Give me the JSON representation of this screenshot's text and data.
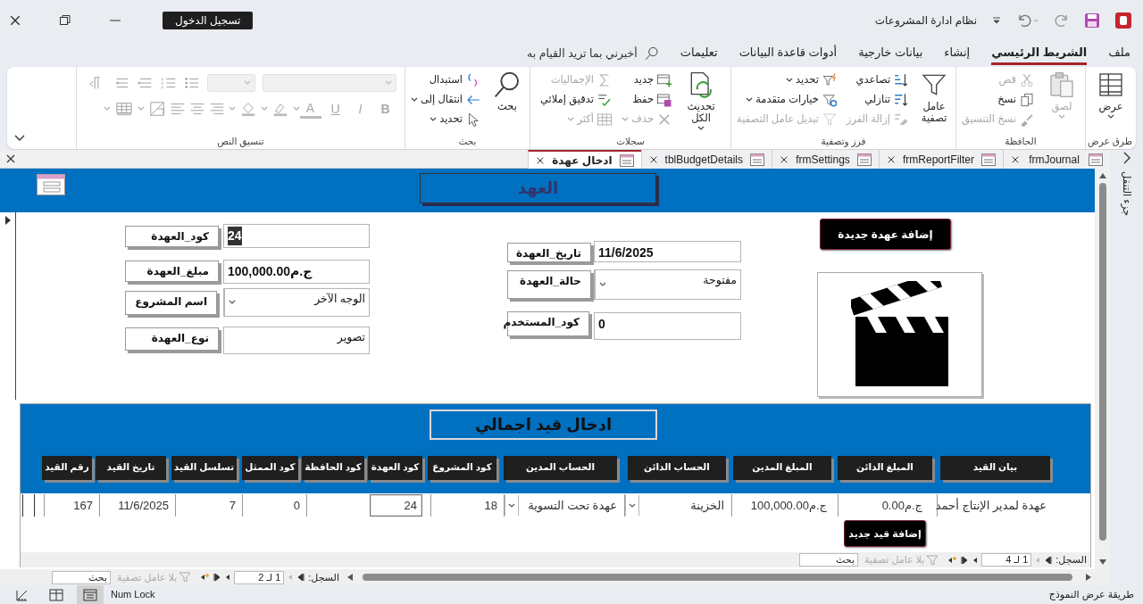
{
  "title_bar": {
    "title": "نظام ادارة المشروعات",
    "sign_in": "تسجيل الدخول"
  },
  "ribbon_tabs": [
    {
      "label": "ملف",
      "selected": false
    },
    {
      "label": "الشريط الرئيسي",
      "selected": true
    },
    {
      "label": "إنشاء",
      "selected": false
    },
    {
      "label": "بيانات خارجية",
      "selected": false
    },
    {
      "label": "أدوات قاعدة البيانات",
      "selected": false
    },
    {
      "label": "تعليمات",
      "selected": false
    }
  ],
  "tell_me": {
    "placeholder": "أخبرني بما تريد القيام به"
  },
  "ribbon_groups": [
    {
      "label": "طرق عرض",
      "commands": [
        {
          "label": "عرض",
          "kind": "large",
          "disabled": false,
          "dropdown": true
        }
      ]
    },
    {
      "label": "الحافظة",
      "commands": [
        {
          "label": "لصق",
          "kind": "large",
          "disabled": true,
          "dropdown": true
        },
        {
          "label": "قص",
          "kind": "small",
          "disabled": true,
          "dropdown": false
        },
        {
          "label": "نسخ",
          "kind": "small",
          "disabled": false,
          "dropdown": false
        },
        {
          "label": "نسخ التنسيق",
          "kind": "small",
          "disabled": true,
          "dropdown": false
        }
      ]
    },
    {
      "label": "فرز وتصفية",
      "commands": [
        {
          "label": "عامل تصفية",
          "kind": "large",
          "disabled": false,
          "dropdown": false
        },
        {
          "label": "تصاعدي",
          "kind": "small",
          "disabled": false,
          "dropdown": false
        },
        {
          "label": "تنازلي",
          "kind": "small",
          "disabled": false,
          "dropdown": false
        },
        {
          "label": "إزالة الفرز",
          "kind": "small",
          "disabled": true,
          "dropdown": false
        },
        {
          "label": "تحديد",
          "kind": "small",
          "disabled": false,
          "dropdown": true
        },
        {
          "label": "خيارات متقدمة",
          "kind": "small",
          "disabled": false,
          "dropdown": true
        },
        {
          "label": "تبديل عامل التصفية",
          "kind": "small",
          "disabled": true,
          "dropdown": false
        }
      ]
    },
    {
      "label": "سجلات",
      "commands": [
        {
          "label": "تحديث الكل",
          "kind": "large",
          "disabled": false,
          "dropdown": true
        },
        {
          "label": "جديد",
          "kind": "small",
          "disabled": false,
          "dropdown": false
        },
        {
          "label": "حفظ",
          "kind": "small",
          "disabled": false,
          "dropdown": false
        },
        {
          "label": "حذف",
          "kind": "small",
          "disabled": true,
          "dropdown": true
        },
        {
          "label": "الإجماليات",
          "kind": "small",
          "disabled": true,
          "dropdown": false
        },
        {
          "label": "تدقيق إملائي",
          "kind": "small",
          "disabled": false,
          "dropdown": false
        },
        {
          "label": "أكثر",
          "kind": "small",
          "disabled": true,
          "dropdown": true
        }
      ]
    },
    {
      "label": "بحث",
      "commands": [
        {
          "label": "بحث",
          "kind": "large",
          "disabled": false,
          "dropdown": false
        },
        {
          "label": "استبدال",
          "kind": "small",
          "disabled": false,
          "dropdown": false
        },
        {
          "label": "انتقال إلى",
          "kind": "small",
          "disabled": false,
          "dropdown": true
        },
        {
          "label": "تحديد",
          "kind": "small",
          "disabled": false,
          "dropdown": true
        }
      ]
    },
    {
      "label": "تنسيق النص",
      "commands": [
        {
          "label": "B",
          "kind": "glyph",
          "disabled": true,
          "dropdown": false
        },
        {
          "label": "I",
          "kind": "glyph",
          "disabled": true,
          "dropdown": false
        },
        {
          "label": "U",
          "kind": "glyph",
          "disabled": true,
          "dropdown": false
        },
        {
          "label": "A",
          "kind": "glyph",
          "disabled": true,
          "dropdown": true
        }
      ]
    }
  ],
  "doc_tabs": [
    {
      "label": "frmJournal",
      "selected": false
    },
    {
      "label": "frmReportFilter",
      "selected": false
    },
    {
      "label": "frmSettings",
      "selected": false
    },
    {
      "label": "tblBudgetDetails",
      "selected": false
    },
    {
      "label": "ادخال عهدة",
      "selected": true
    }
  ],
  "nav_pane": {
    "label": "جزء التنقل"
  },
  "form": {
    "title": "العهد",
    "new_button": "إضافة عهدة جديدة",
    "fields": [
      {
        "label": "تاريخ_العهدة",
        "value": "11/6/2025",
        "kind": "number",
        "text_selected": false
      },
      {
        "label": "حالة_العهدة",
        "value": "مفتوحة",
        "kind": "combo",
        "text_selected": false
      },
      {
        "label": "كود_المستخدم",
        "value": "0",
        "kind": "number",
        "text_selected": false
      },
      {
        "label": "كود_العهدة",
        "value": "24",
        "kind": "number",
        "text_selected": true
      },
      {
        "label": "مبلغ_العهدة",
        "value": "ج.م100,000.00",
        "kind": "number",
        "text_selected": false
      },
      {
        "label": "اسم المشروع",
        "value": "الوجه الآخر",
        "kind": "combo",
        "text_selected": false
      },
      {
        "label": "نوع_العهدة",
        "value": "تصوير",
        "kind": "text",
        "text_selected": false
      }
    ]
  },
  "subform": {
    "title": "ادخال قيد اجمالي",
    "new_button": "إضافة قيد جديد",
    "columns": [
      {
        "header": "بيان القيد",
        "value": "عهدة لمدير الإنتاج أحمد",
        "kind": "text",
        "focused": false
      },
      {
        "header": "المبلغ الدائن",
        "value": "ج.م0.00",
        "kind": "text",
        "focused": false
      },
      {
        "header": "المبلغ المدين",
        "value": "ج.م100,000.00",
        "kind": "text",
        "focused": false
      },
      {
        "header": "الحساب الدائن",
        "value": "الخزينة",
        "kind": "combo",
        "focused": false
      },
      {
        "header": "الحساب المدين",
        "value": "عهدة تحت التسوية",
        "kind": "combo",
        "focused": false
      },
      {
        "header": "كود المشروع",
        "value": "18",
        "kind": "text",
        "focused": false
      },
      {
        "header": "كود العهدة",
        "value": "24",
        "kind": "text",
        "focused": true
      },
      {
        "header": "كود الحافظة",
        "kind": "text",
        "focused": false
      },
      {
        "header": "كود الممثل",
        "value": "0",
        "kind": "text",
        "focused": false
      },
      {
        "header": "تسلسل القيد",
        "value": "7",
        "kind": "text",
        "focused": false
      },
      {
        "header": "تاريخ القيد",
        "value": "11/6/2025",
        "kind": "text",
        "focused": false
      },
      {
        "header": "رقم القيد",
        "value": "167",
        "kind": "text",
        "focused": false
      }
    ],
    "navigator": {
      "label": "السجل:",
      "position": "1 لـ 4",
      "filter": "بلا عامل تصفية",
      "search": {
        "placeholder": "بحث"
      }
    }
  },
  "navigator": {
    "label": "السجل:",
    "position": "1 لـ 2",
    "filter": "بلا عامل تصفية",
    "search": {
      "placeholder": "بحث"
    }
  },
  "status_bar": {
    "text": "طريقة عرض النموذج",
    "num_lock": "Num Lock",
    "view_buttons": [
      {
        "selected": true
      },
      {
        "selected": false
      },
      {
        "selected": false
      }
    ]
  }
}
